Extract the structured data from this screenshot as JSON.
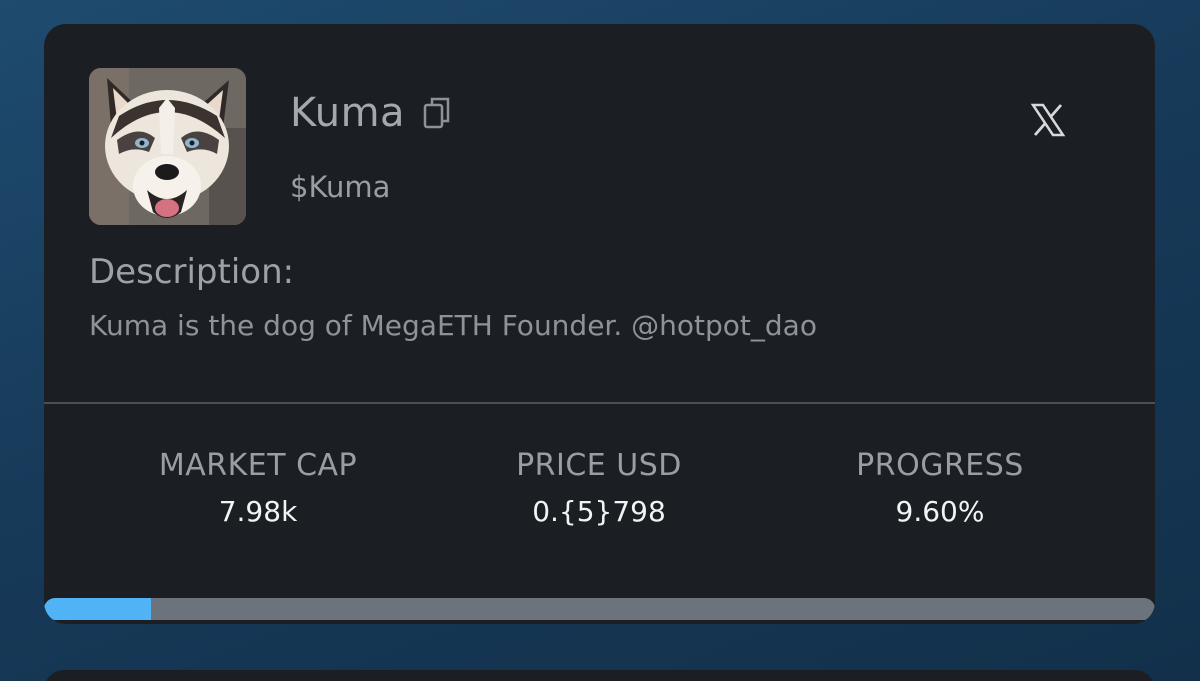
{
  "token": {
    "name": "Kuma",
    "ticker": "$Kuma",
    "avatar_alt": "husky-dog-avatar"
  },
  "description": {
    "heading": "Description:",
    "text": "Kuma is the dog of MegaETH Founder. @hotpot_dao"
  },
  "stats": [
    {
      "label": "MARKET CAP",
      "value": "7.98k"
    },
    {
      "label": "PRICE USD",
      "value": "0.{5}798"
    },
    {
      "label": "PROGRESS",
      "value": "9.60%"
    }
  ],
  "progress_bar": {
    "percent": 9.6
  },
  "colors": {
    "background": "#173a59",
    "card": "#1b1f24",
    "progress_fill": "#4fb3f5",
    "progress_track": "#6c737c"
  },
  "icons": {
    "copy": "copy-icon",
    "social": "x-icon"
  }
}
